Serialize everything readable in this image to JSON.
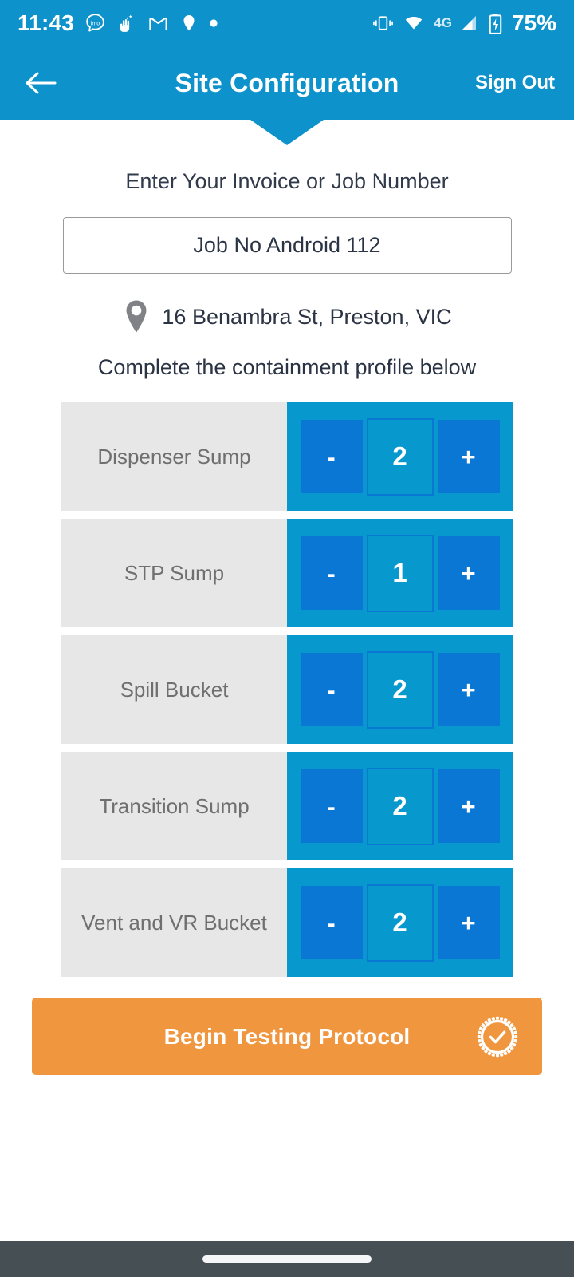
{
  "statusbar": {
    "time": "11:43",
    "battery_percent": "75%",
    "network_type": "4G",
    "left_icons": [
      "imo-icon",
      "hand-sparkle-icon",
      "gmail-icon",
      "location-pin-icon",
      "dot-icon"
    ],
    "right_icons": [
      "vibrate-icon",
      "wifi-icon",
      "signal-bars-icon",
      "battery-charging-icon"
    ]
  },
  "header": {
    "title": "Site Configuration",
    "back_icon": "back-arrow-icon",
    "sign_out_label": "Sign Out"
  },
  "form": {
    "prompt": "Enter Your Invoice or Job Number",
    "job_number_value": "Job No Android 112",
    "job_number_placeholder": "Job No",
    "address": "16 Benambra St, Preston, VIC",
    "address_icon": "map-pin-icon",
    "subprompt": "Complete the containment profile below"
  },
  "counters": {
    "decrement_label": "-",
    "increment_label": "+",
    "rows": [
      {
        "label": "Dispenser Sump",
        "value": "2"
      },
      {
        "label": "STP Sump",
        "value": "1"
      },
      {
        "label": "Spill Bucket",
        "value": "2"
      },
      {
        "label": "Transition Sump",
        "value": "2"
      },
      {
        "label": "Vent and VR Bucket",
        "value": "2"
      }
    ]
  },
  "cta": {
    "label": "Begin Testing Protocol",
    "icon": "verified-check-badge-icon"
  },
  "navbar": {
    "gesture_pill": "home-gesture-pill"
  },
  "colors": {
    "brand_blue": "#0D92CC",
    "panel_blue": "#0799CE",
    "button_blue": "#0A77D5",
    "label_gray": "#E7E7E7",
    "accent_orange": "#F0963F",
    "navbar_gray": "#464F54"
  }
}
